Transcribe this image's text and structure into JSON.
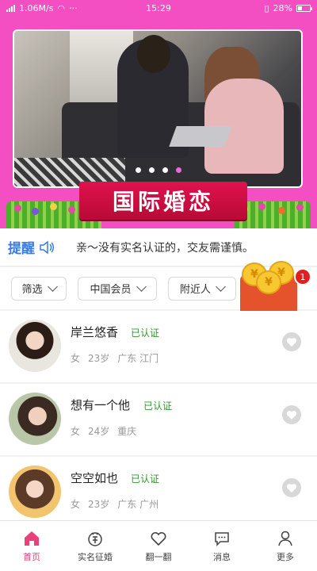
{
  "status_bar": {
    "speed": "1.06M/s",
    "time": "15:29",
    "battery": "28%"
  },
  "banner": {
    "title": "国际婚恋",
    "dots": 4,
    "active_dot": 3
  },
  "notice": {
    "title": "提醒",
    "text": "亲～没有实名认证的，交友需谨慎。"
  },
  "filters": [
    {
      "label": "筛选"
    },
    {
      "label": "中国会员"
    },
    {
      "label": "附近人"
    }
  ],
  "red_packet": {
    "badge": "1",
    "coin_symbol": "¥"
  },
  "users": [
    {
      "name": "岸兰悠香",
      "verified": "已认证",
      "gender": "女",
      "age": "23岁",
      "location": "广东 江门"
    },
    {
      "name": "想有一个他",
      "verified": "已认证",
      "gender": "女",
      "age": "24岁",
      "location": "重庆"
    },
    {
      "name": "空空如也",
      "verified": "已认证",
      "gender": "女",
      "age": "23岁",
      "location": "广东 广州"
    }
  ],
  "tabs": [
    {
      "label": "首页",
      "icon": "home-icon",
      "active": true
    },
    {
      "label": "实名征婚",
      "icon": "verified-marriage-icon"
    },
    {
      "label": "翻一翻",
      "icon": "heart-icon"
    },
    {
      "label": "消息",
      "icon": "message-icon"
    },
    {
      "label": "更多",
      "icon": "person-icon"
    }
  ],
  "colors": {
    "accent": "#f34fc3",
    "active_tab": "#ec3f79",
    "verified": "#2e9b2e",
    "notice_title": "#3a7be0"
  }
}
